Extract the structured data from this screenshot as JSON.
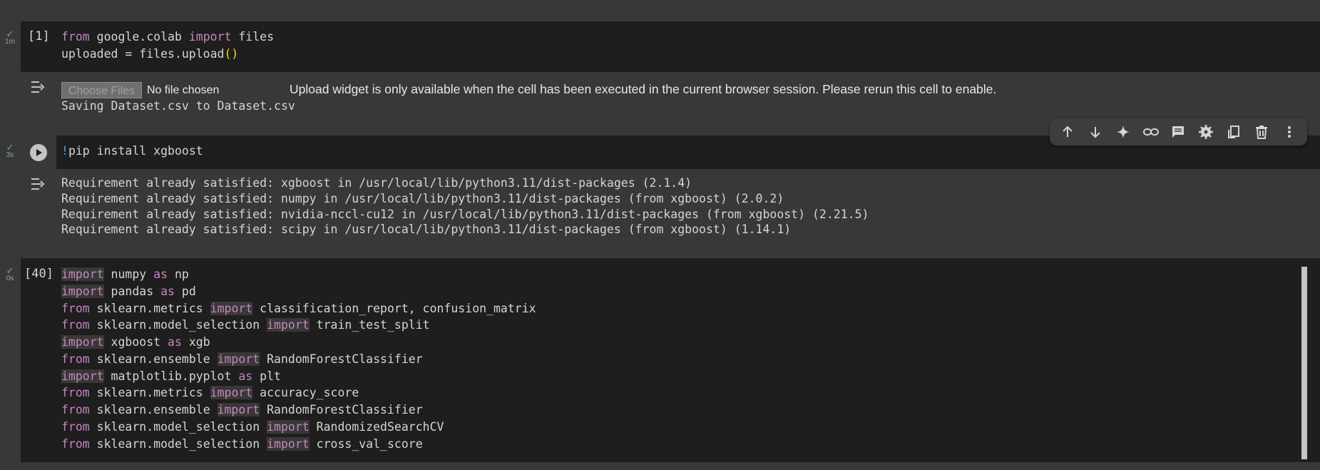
{
  "cells": [
    {
      "status": "1m",
      "exec_count": "[1]",
      "lines": [
        "from google.colab import files",
        "uploaded = files.upload()"
      ],
      "output": {
        "choose_files_label": "Choose Files",
        "no_file_text": "No file chosen",
        "upload_message": "Upload widget is only available when the cell has been executed in the current browser session. Please rerun this cell to enable.",
        "saving_text": "Saving Dataset.csv to Dataset.csv"
      }
    },
    {
      "status": "3s",
      "line": "!pip install xgboost",
      "output_lines": [
        "Requirement already satisfied: xgboost in /usr/local/lib/python3.11/dist-packages (2.1.4)",
        "Requirement already satisfied: numpy in /usr/local/lib/python3.11/dist-packages (from xgboost) (2.0.2)",
        "Requirement already satisfied: nvidia-nccl-cu12 in /usr/local/lib/python3.11/dist-packages (from xgboost) (2.21.5)",
        "Requirement already satisfied: scipy in /usr/local/lib/python3.11/dist-packages (from xgboost) (1.14.1)"
      ]
    },
    {
      "status": "0s",
      "exec_count": "[40]",
      "lines": [
        "import numpy as np",
        "import pandas as pd",
        "from sklearn.metrics import classification_report, confusion_matrix",
        "from sklearn.model_selection import train_test_split",
        "import xgboost as xgb",
        "from sklearn.ensemble import RandomForestClassifier",
        "import matplotlib.pyplot as plt",
        "from sklearn.metrics import accuracy_score",
        "from sklearn.ensemble import RandomForestClassifier",
        "from sklearn.model_selection import RandomizedSearchCV",
        "from sklearn.model_selection import cross_val_score"
      ]
    }
  ],
  "toolbar": [
    "arrow-up-icon",
    "arrow-down-icon",
    "sparkle-icon",
    "link-icon",
    "comment-icon",
    "gear-icon",
    "mirror-cell-icon",
    "trash-icon",
    "more-vert-icon"
  ],
  "colors": {
    "keyword": "#c586c0",
    "paren": "#ffd700",
    "bang": "#569cd6",
    "check": "#5bb974"
  }
}
